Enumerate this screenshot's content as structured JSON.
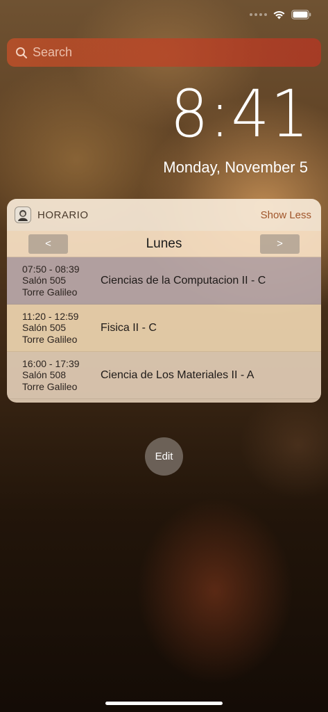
{
  "search": {
    "placeholder": "Search"
  },
  "lockscreen": {
    "time": "8:41",
    "date": "Monday, November 5"
  },
  "widget": {
    "app_name": "HORARIO",
    "show_less_label": "Show Less",
    "day_title": "Lunes",
    "prev_label": "<",
    "next_label": ">",
    "classes": [
      {
        "time": "07:50 - 08:39",
        "room": "Salón 505",
        "building": "Torre Galileo",
        "name": "Ciencias de la Computacion II - C"
      },
      {
        "time": "11:20 - 12:59",
        "room": "Salón 505",
        "building": "Torre Galileo",
        "name": "Fisica II - C"
      },
      {
        "time": "16:00 - 17:39",
        "room": "Salón 508",
        "building": "Torre Galileo",
        "name": "Ciencia de Los Materiales II - A"
      }
    ]
  },
  "edit_label": "Edit",
  "icons": {
    "status": [
      "signal-icon",
      "wifi-icon",
      "battery-icon"
    ],
    "search": "search-icon",
    "app": "app-icon"
  },
  "colors": {
    "search_bar": "#c0482a",
    "show_less": "#a0552a",
    "highlight_row": "#8c7d96"
  }
}
